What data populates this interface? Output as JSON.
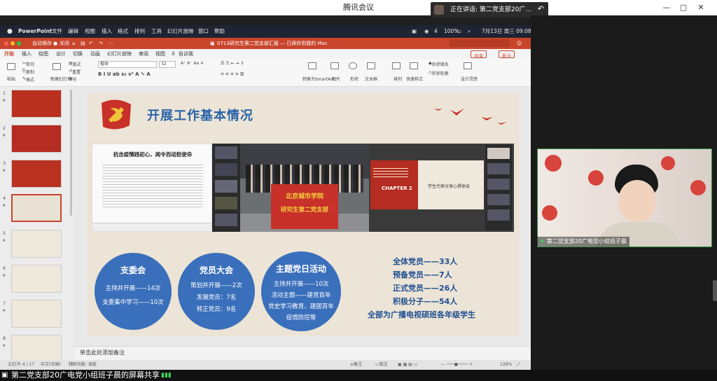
{
  "meeting": {
    "title": "腾讯会议",
    "speaking_label": "正在讲话: 第二党支部20广…",
    "video_name": "第二党支部20广电党小组班子晨",
    "share_label": "第二党支部20广电党小组班子晨的屏幕共享"
  },
  "menubar": {
    "app": "PowerPoint",
    "items": [
      "文件",
      "编辑",
      "视图",
      "插入",
      "格式",
      "排列",
      "工具",
      "幻灯片放映",
      "窗口",
      "帮助"
    ],
    "battery": "100%",
    "date_time": "7月13日 周三 09:08",
    "count": "4"
  },
  "ppt": {
    "autosave": "自动保存",
    "autosave_state": "关闭",
    "doc_title": "0713研究生第二党支部汇报 — 已保存到我的 Mac",
    "search_placeholder": "",
    "tabs": [
      "开始",
      "插入",
      "绘图",
      "设计",
      "切换",
      "动画",
      "幻灯片放映",
      "审阅",
      "视图",
      "告诉我"
    ],
    "share": "共享",
    "comment": "批注",
    "ribbon": {
      "paste": "粘贴",
      "cut": "剪切",
      "copy": "复制",
      "format": "格式",
      "new_slide": "新建幻灯片",
      "layout": "版式",
      "reset": "重置",
      "section": "节",
      "font": "楷体",
      "size": "32",
      "convert_smartart": "转换为SmartArt",
      "picture": "图片",
      "shape": "形状",
      "textbox": "文本框",
      "arrange": "排列",
      "quick_styles": "快速样式",
      "shape_fill": "形状填充",
      "shape_outline": "形状轮廓",
      "designer": "设计灵感"
    },
    "notes": "单击此处添加备注",
    "status": {
      "slide": "幻灯片 4 / 17",
      "lang": "中文(中国)",
      "accessibility": "辅助功能: 调查",
      "notes": "备注",
      "comments": "批注",
      "zoom": "128%"
    },
    "thumbnails": [
      {
        "num": "1"
      },
      {
        "num": "2"
      },
      {
        "num": "3"
      },
      {
        "num": "4"
      },
      {
        "num": "5"
      },
      {
        "num": "6"
      },
      {
        "num": "7"
      },
      {
        "num": "8"
      }
    ]
  },
  "slide": {
    "title": "开展工作基本情况",
    "article_title": "抗击疫情践初心，闻令而动担使命",
    "banner_line1": "北京城市学院",
    "banner_line2": "研究生第二党支部",
    "chapter": "CHAPTER 2",
    "chapter_sub": "学生代表分享心得体会",
    "circles": [
      {
        "title": "支委会",
        "lines": [
          "主持并开展——14次",
          "支委集中学习——10次"
        ]
      },
      {
        "title": "党员大会",
        "lines": [
          "策划并开展——2次",
          "发展党员：7名",
          "转正党员：9名"
        ]
      },
      {
        "title": "主题党日活动",
        "lines": [
          "主持并开展——10次",
          "活动主题——建党百年",
          "党史学习教育、建团百年",
          "疫情防控等"
        ]
      }
    ],
    "stats": [
      "全体党员——33人",
      "预备党员——7人",
      "正式党员——26人",
      "积极分子——54人",
      "全部为广播电视硕班各年级学生"
    ],
    "colors": {
      "accent": "#3a6fbb",
      "title": "#2a64a8",
      "party_red": "#c8302a",
      "background": "#ece4d6"
    }
  }
}
